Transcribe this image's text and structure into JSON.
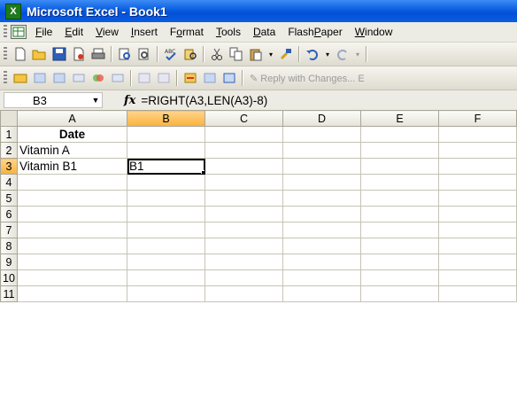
{
  "window": {
    "title": "Microsoft Excel - Book1",
    "app_icon_glyph": "X"
  },
  "menu": {
    "items": [
      {
        "label": "File",
        "underline": "F"
      },
      {
        "label": "Edit",
        "underline": "E"
      },
      {
        "label": "View",
        "underline": "V"
      },
      {
        "label": "Insert",
        "underline": "I"
      },
      {
        "label": "Format",
        "underline": "o"
      },
      {
        "label": "Tools",
        "underline": "T"
      },
      {
        "label": "Data",
        "underline": "D"
      },
      {
        "label": "FlashPaper",
        "underline": "P"
      },
      {
        "label": "Window",
        "underline": "W"
      }
    ]
  },
  "review_toolbar": {
    "reply_label": "Reply with Changes...",
    "trailing": "E"
  },
  "formula_bar": {
    "name_box": "B3",
    "fx": "fx",
    "formula": "=RIGHT(A3,LEN(A3)-8)"
  },
  "sheet": {
    "columns": [
      "A",
      "B",
      "C",
      "D",
      "E",
      "F"
    ],
    "selected_column": "B",
    "selected_row": "3",
    "rows": [
      {
        "num": "1",
        "cells": [
          "Date",
          "",
          "",
          "",
          "",
          ""
        ]
      },
      {
        "num": "2",
        "cells": [
          "Vitamin A",
          "",
          "",
          "",
          "",
          ""
        ]
      },
      {
        "num": "3",
        "cells": [
          "Vitamin B1",
          "B1",
          "",
          "",
          "",
          ""
        ]
      },
      {
        "num": "4",
        "cells": [
          "",
          "",
          "",
          "",
          "",
          ""
        ]
      },
      {
        "num": "5",
        "cells": [
          "",
          "",
          "",
          "",
          "",
          ""
        ]
      },
      {
        "num": "6",
        "cells": [
          "",
          "",
          "",
          "",
          "",
          ""
        ]
      },
      {
        "num": "7",
        "cells": [
          "",
          "",
          "",
          "",
          "",
          ""
        ]
      },
      {
        "num": "8",
        "cells": [
          "",
          "",
          "",
          "",
          "",
          ""
        ]
      },
      {
        "num": "9",
        "cells": [
          "",
          "",
          "",
          "",
          "",
          ""
        ]
      },
      {
        "num": "10",
        "cells": [
          "",
          "",
          "",
          "",
          "",
          ""
        ]
      },
      {
        "num": "11",
        "cells": [
          "",
          "",
          "",
          "",
          "",
          ""
        ]
      }
    ]
  },
  "icons": {
    "toolbar1": [
      "new-icon",
      "open-icon",
      "save-icon",
      "permission-icon",
      "print-icon",
      "print-preview-icon",
      "spelling-icon",
      "research-icon",
      "cut-icon",
      "copy-icon",
      "paste-icon",
      "format-painter-icon",
      "undo-icon",
      "redo-icon"
    ],
    "toolbar2": [
      "review-icon-1",
      "review-icon-2",
      "review-icon-3",
      "review-icon-4",
      "review-icon-5",
      "review-icon-6",
      "review-icon-7",
      "review-icon-8",
      "review-icon-9",
      "review-icon-10",
      "review-icon-11"
    ]
  },
  "colors": {
    "title_bar": "#0a5ee0",
    "selection_header": "#f9b23c",
    "grid_line": "#c6c3b6"
  }
}
